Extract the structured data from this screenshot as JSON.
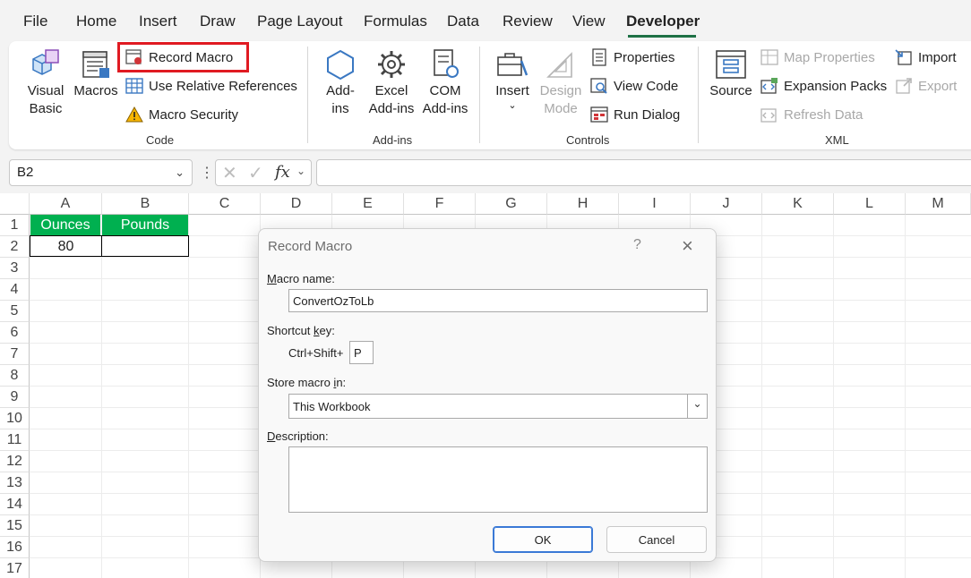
{
  "tabs": [
    "File",
    "Home",
    "Insert",
    "Draw",
    "Page Layout",
    "Formulas",
    "Data",
    "Review",
    "View",
    "Developer"
  ],
  "active_tab": "Developer",
  "ribbon": {
    "code": {
      "label": "Code",
      "visual_basic": [
        "Visual",
        "Basic"
      ],
      "macros": "Macros",
      "record_macro": "Record Macro",
      "use_relative": "Use Relative References",
      "macro_security": "Macro Security"
    },
    "addins": {
      "label": "Add-ins",
      "addins": [
        "Add-",
        "ins"
      ],
      "excel_addins": [
        "Excel",
        "Add-ins"
      ],
      "com_addins": [
        "COM",
        "Add-ins"
      ]
    },
    "controls": {
      "label": "Controls",
      "insert": "Insert",
      "design_mode": [
        "Design",
        "Mode"
      ],
      "properties": "Properties",
      "view_code": "View Code",
      "run_dialog": "Run Dialog"
    },
    "xml": {
      "label": "XML",
      "source": "Source",
      "map_properties": "Map Properties",
      "expansion_packs": "Expansion Packs",
      "refresh_data": "Refresh Data",
      "import": "Import",
      "export": "Export"
    }
  },
  "formula_bar": {
    "name_box": "B2",
    "fx": "fx",
    "formula": ""
  },
  "sheet": {
    "columns": [
      "A",
      "B",
      "C",
      "D",
      "E",
      "F",
      "G",
      "H",
      "I",
      "J",
      "K",
      "L",
      "M"
    ],
    "rows": [
      "1",
      "2",
      "3",
      "4",
      "5",
      "6",
      "7",
      "8",
      "9",
      "10",
      "11",
      "12",
      "13",
      "14",
      "15",
      "16",
      "17"
    ],
    "a1": "Ounces",
    "b1": "Pounds",
    "a2": "80",
    "b2": "",
    "header_fill": "#00b050"
  },
  "dialog": {
    "title": "Record Macro",
    "help": "?",
    "macro_name_label": {
      "pre": "",
      "ul": "M",
      "post": "acro name:"
    },
    "macro_name_value": "ConvertOzToLb",
    "shortcut_label": {
      "pre": "Shortcut ",
      "ul": "k",
      "post": "ey:"
    },
    "shortcut_prefix": "Ctrl+Shift+",
    "shortcut_value": "P",
    "store_label": {
      "pre": "Store macro ",
      "ul": "i",
      "post": "n:"
    },
    "store_value": "This Workbook",
    "description_label": {
      "pre": "",
      "ul": "D",
      "post": "escription:"
    },
    "description_value": "",
    "ok": "OK",
    "cancel": "Cancel"
  },
  "colors": {
    "accent": "#1e7145",
    "highlight": "#e01a22"
  }
}
